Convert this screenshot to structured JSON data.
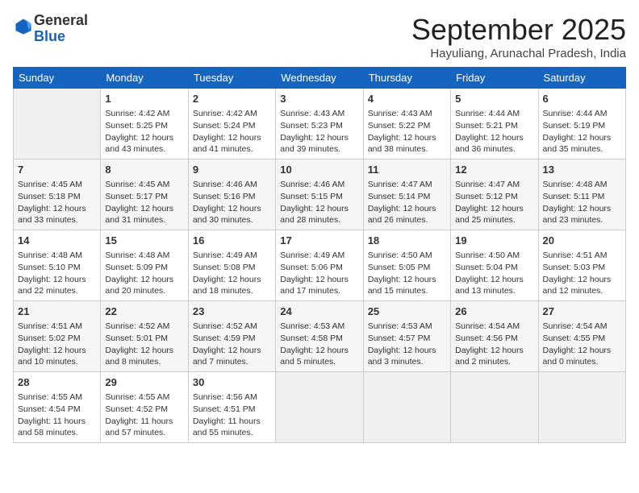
{
  "logo": {
    "general": "General",
    "blue": "Blue"
  },
  "title": "September 2025",
  "location": "Hayuliang, Arunachal Pradesh, India",
  "days_header": [
    "Sunday",
    "Monday",
    "Tuesday",
    "Wednesday",
    "Thursday",
    "Friday",
    "Saturday"
  ],
  "weeks": [
    [
      {
        "day": "",
        "text": ""
      },
      {
        "day": "1",
        "text": "Sunrise: 4:42 AM\nSunset: 5:25 PM\nDaylight: 12 hours\nand 43 minutes."
      },
      {
        "day": "2",
        "text": "Sunrise: 4:42 AM\nSunset: 5:24 PM\nDaylight: 12 hours\nand 41 minutes."
      },
      {
        "day": "3",
        "text": "Sunrise: 4:43 AM\nSunset: 5:23 PM\nDaylight: 12 hours\nand 39 minutes."
      },
      {
        "day": "4",
        "text": "Sunrise: 4:43 AM\nSunset: 5:22 PM\nDaylight: 12 hours\nand 38 minutes."
      },
      {
        "day": "5",
        "text": "Sunrise: 4:44 AM\nSunset: 5:21 PM\nDaylight: 12 hours\nand 36 minutes."
      },
      {
        "day": "6",
        "text": "Sunrise: 4:44 AM\nSunset: 5:19 PM\nDaylight: 12 hours\nand 35 minutes."
      }
    ],
    [
      {
        "day": "7",
        "text": "Sunrise: 4:45 AM\nSunset: 5:18 PM\nDaylight: 12 hours\nand 33 minutes."
      },
      {
        "day": "8",
        "text": "Sunrise: 4:45 AM\nSunset: 5:17 PM\nDaylight: 12 hours\nand 31 minutes."
      },
      {
        "day": "9",
        "text": "Sunrise: 4:46 AM\nSunset: 5:16 PM\nDaylight: 12 hours\nand 30 minutes."
      },
      {
        "day": "10",
        "text": "Sunrise: 4:46 AM\nSunset: 5:15 PM\nDaylight: 12 hours\nand 28 minutes."
      },
      {
        "day": "11",
        "text": "Sunrise: 4:47 AM\nSunset: 5:14 PM\nDaylight: 12 hours\nand 26 minutes."
      },
      {
        "day": "12",
        "text": "Sunrise: 4:47 AM\nSunset: 5:12 PM\nDaylight: 12 hours\nand 25 minutes."
      },
      {
        "day": "13",
        "text": "Sunrise: 4:48 AM\nSunset: 5:11 PM\nDaylight: 12 hours\nand 23 minutes."
      }
    ],
    [
      {
        "day": "14",
        "text": "Sunrise: 4:48 AM\nSunset: 5:10 PM\nDaylight: 12 hours\nand 22 minutes."
      },
      {
        "day": "15",
        "text": "Sunrise: 4:48 AM\nSunset: 5:09 PM\nDaylight: 12 hours\nand 20 minutes."
      },
      {
        "day": "16",
        "text": "Sunrise: 4:49 AM\nSunset: 5:08 PM\nDaylight: 12 hours\nand 18 minutes."
      },
      {
        "day": "17",
        "text": "Sunrise: 4:49 AM\nSunset: 5:06 PM\nDaylight: 12 hours\nand 17 minutes."
      },
      {
        "day": "18",
        "text": "Sunrise: 4:50 AM\nSunset: 5:05 PM\nDaylight: 12 hours\nand 15 minutes."
      },
      {
        "day": "19",
        "text": "Sunrise: 4:50 AM\nSunset: 5:04 PM\nDaylight: 12 hours\nand 13 minutes."
      },
      {
        "day": "20",
        "text": "Sunrise: 4:51 AM\nSunset: 5:03 PM\nDaylight: 12 hours\nand 12 minutes."
      }
    ],
    [
      {
        "day": "21",
        "text": "Sunrise: 4:51 AM\nSunset: 5:02 PM\nDaylight: 12 hours\nand 10 minutes."
      },
      {
        "day": "22",
        "text": "Sunrise: 4:52 AM\nSunset: 5:01 PM\nDaylight: 12 hours\nand 8 minutes."
      },
      {
        "day": "23",
        "text": "Sunrise: 4:52 AM\nSunset: 4:59 PM\nDaylight: 12 hours\nand 7 minutes."
      },
      {
        "day": "24",
        "text": "Sunrise: 4:53 AM\nSunset: 4:58 PM\nDaylight: 12 hours\nand 5 minutes."
      },
      {
        "day": "25",
        "text": "Sunrise: 4:53 AM\nSunset: 4:57 PM\nDaylight: 12 hours\nand 3 minutes."
      },
      {
        "day": "26",
        "text": "Sunrise: 4:54 AM\nSunset: 4:56 PM\nDaylight: 12 hours\nand 2 minutes."
      },
      {
        "day": "27",
        "text": "Sunrise: 4:54 AM\nSunset: 4:55 PM\nDaylight: 12 hours\nand 0 minutes."
      }
    ],
    [
      {
        "day": "28",
        "text": "Sunrise: 4:55 AM\nSunset: 4:54 PM\nDaylight: 11 hours\nand 58 minutes."
      },
      {
        "day": "29",
        "text": "Sunrise: 4:55 AM\nSunset: 4:52 PM\nDaylight: 11 hours\nand 57 minutes."
      },
      {
        "day": "30",
        "text": "Sunrise: 4:56 AM\nSunset: 4:51 PM\nDaylight: 11 hours\nand 55 minutes."
      },
      {
        "day": "",
        "text": ""
      },
      {
        "day": "",
        "text": ""
      },
      {
        "day": "",
        "text": ""
      },
      {
        "day": "",
        "text": ""
      }
    ]
  ]
}
